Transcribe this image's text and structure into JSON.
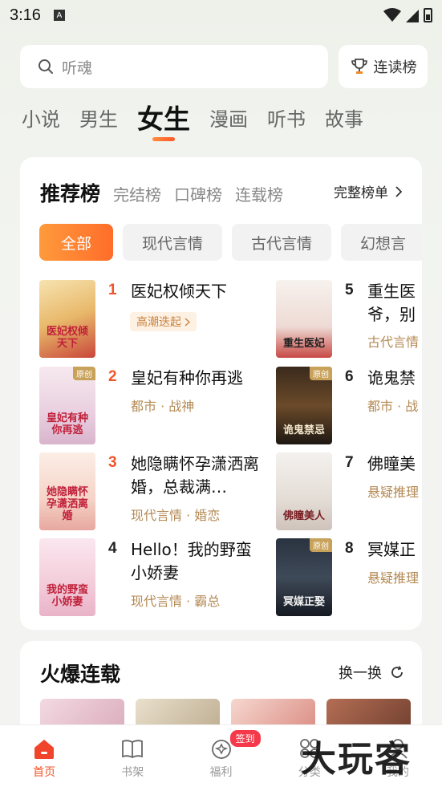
{
  "status_bar": {
    "time": "3:16",
    "notif_icon_letter": "A"
  },
  "search": {
    "placeholder": "听魂"
  },
  "rank_button": {
    "label": "连读榜"
  },
  "category_tabs": [
    {
      "label": "小说",
      "active": false
    },
    {
      "label": "男生",
      "active": false
    },
    {
      "label": "女生",
      "active": true
    },
    {
      "label": "漫画",
      "active": false
    },
    {
      "label": "听书",
      "active": false
    },
    {
      "label": "故事",
      "active": false
    }
  ],
  "ranking_card": {
    "title": "推荐榜",
    "sub_tabs": [
      "完结榜",
      "口碑榜",
      "连载榜"
    ],
    "full_list_label": "完整榜单",
    "filters": [
      "全部",
      "现代言情",
      "古代言情",
      "幻想言"
    ],
    "items": [
      {
        "rank": "1",
        "title": "医妃权倾天下",
        "meta": "",
        "pill": "高潮迭起",
        "cover_text": "医妃权倾天下",
        "original": false
      },
      {
        "rank": "2",
        "title": "皇妃有种你再逃",
        "meta": "都市 · 战神",
        "pill": "",
        "cover_text": "皇妃有种你再逃",
        "original": true
      },
      {
        "rank": "3",
        "title": "她隐瞒怀孕潇洒离婚，总裁满…",
        "meta": "现代言情 · 婚恋",
        "pill": "",
        "cover_text": "她隐瞒怀孕潇洒离婚",
        "original": false
      },
      {
        "rank": "4",
        "title": "Hello！我的野蛮小娇妻",
        "meta": "现代言情 · 霸总",
        "pill": "",
        "cover_text": "我的野蛮小娇妻",
        "original": false
      },
      {
        "rank": "5",
        "title": "重生医",
        "title2": "爷，别",
        "meta": "古代言情",
        "pill": "",
        "cover_text": "重生医妃",
        "original": false
      },
      {
        "rank": "6",
        "title": "诡鬼禁",
        "meta": "都市 · 战",
        "pill": "",
        "cover_text": "诡鬼禁忌",
        "original": true
      },
      {
        "rank": "7",
        "title": "佛瞳美",
        "meta": "悬疑推理",
        "pill": "",
        "cover_text": "佛瞳美人",
        "original": false
      },
      {
        "rank": "8",
        "title": "冥媒正",
        "meta": "悬疑推理",
        "pill": "",
        "cover_text": "冥媒正娶",
        "original": true
      }
    ],
    "original_tag": "原创"
  },
  "hot_card": {
    "title": "火爆连载",
    "refresh_label": "换一换"
  },
  "bottom_nav": [
    {
      "label": "首页",
      "icon": "home-icon",
      "active": true
    },
    {
      "label": "书架",
      "icon": "bookshelf-icon",
      "active": false
    },
    {
      "label": "福利",
      "icon": "gift-icon",
      "active": false,
      "badge": "签到"
    },
    {
      "label": "分类",
      "icon": "category-icon",
      "active": false
    },
    {
      "label": "我的",
      "icon": "profile-icon",
      "active": false
    }
  ],
  "watermark": "大玩客",
  "colors": {
    "accent": "#f0552a",
    "meta": "#b48a54",
    "pill_bg": "#fdf1e4"
  }
}
